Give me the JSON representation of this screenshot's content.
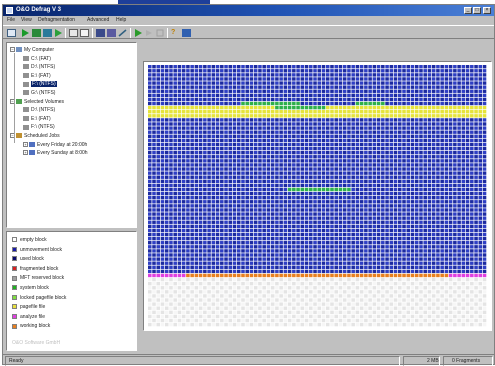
{
  "window": {
    "title": "O&O Defrag V 3",
    "buttons": [
      "_",
      "□",
      "×"
    ]
  },
  "menu": [
    "File",
    "View",
    "Defragmentation",
    "Advanced",
    "Help"
  ],
  "toolbar": {
    "icons": [
      "new-icon",
      "start-icon",
      "stop-icon",
      "pause-icon",
      "refresh-icon",
      "view-icon",
      "list-icon",
      "graph-icon",
      "chart-icon",
      "tool-icon",
      "schedule-icon",
      "play-icon",
      "report-icon",
      "help-icon",
      "about-icon"
    ]
  },
  "tree": {
    "nodes": [
      {
        "label": "My Computer",
        "expander": "−",
        "icon": "computer-icon",
        "level": 0
      },
      {
        "label": "C:\\ (FAT)",
        "icon": "drive-icon",
        "level": 1
      },
      {
        "label": "D:\\ (NTFS)",
        "icon": "drive-icon",
        "level": 1
      },
      {
        "label": "E:\\ (FAT)",
        "icon": "drive-icon",
        "level": 1
      },
      {
        "label": "F:\\ (NTFS)",
        "icon": "drive-icon",
        "level": 1,
        "selected": true
      },
      {
        "label": "G:\\ (NTFS)",
        "icon": "drive-icon",
        "level": 1
      },
      {
        "label": "Selected Volumes",
        "expander": "−",
        "icon": "volumes-icon",
        "level": 0
      },
      {
        "label": "D:\\ (NTFS)",
        "icon": "drive-icon",
        "level": 1
      },
      {
        "label": "E:\\ (FAT)",
        "icon": "drive-icon",
        "level": 1
      },
      {
        "label": "F:\\ (NTFS)",
        "icon": "drive-icon",
        "level": 1
      },
      {
        "label": "Scheduled Jobs",
        "expander": "−",
        "icon": "schedule-icon",
        "level": 0
      },
      {
        "label": "Every Friday at 20:00h",
        "expander": "+",
        "icon": "job-icon",
        "level": 1
      },
      {
        "label": "Every Sunday at 8:00h",
        "expander": "+",
        "icon": "job-icon",
        "level": 1
      }
    ]
  },
  "legend": {
    "items": [
      {
        "label": "empty block",
        "color": "#ffffff"
      },
      {
        "label": "unmovement block",
        "color": "#1a1aa8"
      },
      {
        "label": "used block",
        "color": "#0a0a6a"
      },
      {
        "label": "fragmented block",
        "color": "#d82020"
      },
      {
        "label": "MFT reserved block",
        "color": "#a0a0a0"
      },
      {
        "label": "system block",
        "color": "#20b020"
      },
      {
        "label": "locked pagefile block",
        "color": "#80e040"
      },
      {
        "label": "pagefile file",
        "color": "#e8e040"
      },
      {
        "label": "analyze file",
        "color": "#e040e0"
      },
      {
        "label": "working block",
        "color": "#e88020"
      }
    ],
    "footer": "O&O Software GmbH"
  },
  "status": {
    "left": "Ready",
    "mid": "2 MB",
    "right": "0 Fragments"
  },
  "colors": {
    "used": "#1c2aa0",
    "used_alt": "#2f3fc4",
    "pagefile": "#e6e43a",
    "system": "#2eb04a",
    "empty": "#e4e4e4",
    "empty_alt": "#f6f6f6",
    "analyze": "#e040e0",
    "working": "#e88020"
  },
  "map": {
    "type": "block-map",
    "cols": 80,
    "rows": 64,
    "regions": [
      {
        "kind": "used",
        "rows": [
          0,
          9
        ]
      },
      {
        "kind": "pagefile",
        "rows": [
          10,
          12
        ]
      },
      {
        "kind": "used",
        "rows": [
          13,
          50
        ]
      },
      {
        "kind": "analyze",
        "rows": [
          51,
          51
        ],
        "cols": [
          0,
          8
        ]
      },
      {
        "kind": "working",
        "rows": [
          51,
          51
        ],
        "cols": [
          9,
          70
        ]
      },
      {
        "kind": "analyze",
        "rows": [
          51,
          51
        ],
        "cols": [
          71,
          79
        ]
      },
      {
        "kind": "empty",
        "rows": [
          52,
          63
        ]
      }
    ],
    "system_segments": [
      {
        "row": 9,
        "cols": [
          22,
          35
        ]
      },
      {
        "row": 10,
        "cols": [
          30,
          41
        ]
      },
      {
        "row": 9,
        "cols": [
          49,
          55
        ]
      },
      {
        "row": 30,
        "cols": [
          33,
          47
        ]
      }
    ]
  }
}
